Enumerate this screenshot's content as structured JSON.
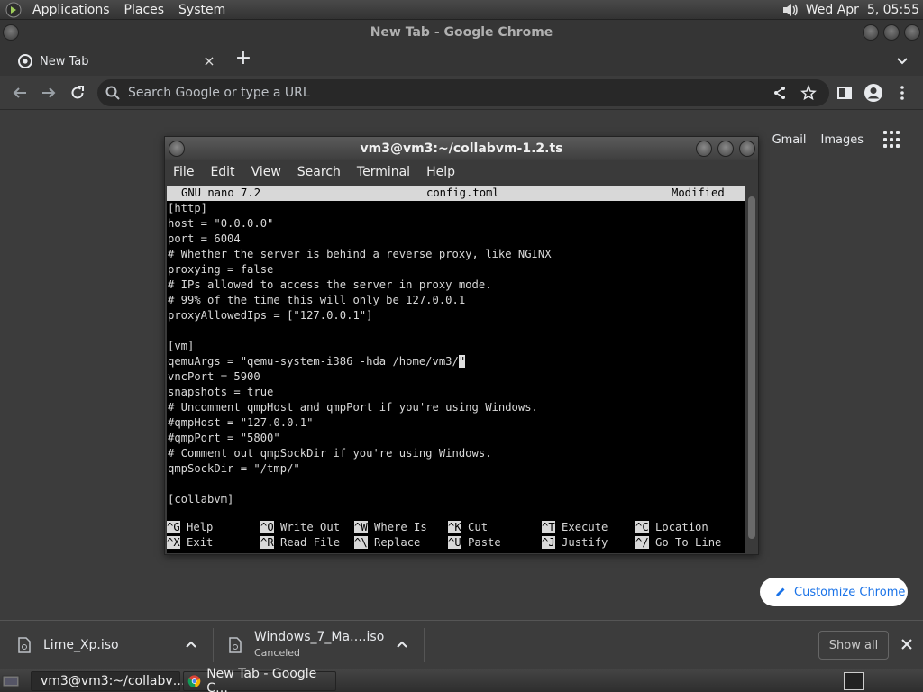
{
  "top_panel": {
    "menus": [
      "Applications",
      "Places",
      "System"
    ],
    "datetime": "Wed Apr  5, 05:55",
    "icon": "volume-icon"
  },
  "chrome": {
    "window_title": "New Tab - Google Chrome",
    "tab": {
      "title": "New Tab"
    },
    "omnibox_placeholder": "Search Google or type a URL",
    "ntp": {
      "gmail": "Gmail",
      "images": "Images",
      "customize": "Customize Chrome"
    }
  },
  "terminal": {
    "title": "vm3@vm3:~/collabvm-1.2.ts",
    "menus": [
      "File",
      "Edit",
      "View",
      "Search",
      "Terminal",
      "Help"
    ],
    "nano": {
      "version": "GNU nano 7.2",
      "filename": "config.toml",
      "status": "Modified",
      "lines": [
        "[http]",
        "host = \"0.0.0.0\"",
        "port = 6004",
        "# Whether the server is behind a reverse proxy, like NGINX",
        "proxying = false",
        "# IPs allowed to access the server in proxy mode.",
        "# 99% of the time this will only be 127.0.0.1",
        "proxyAllowedIps = [\"127.0.0.1\"]",
        "",
        "[vm]",
        "qemuArgs = \"qemu-system-i386 -hda /home/vm3/",
        "vncPort = 5900",
        "snapshots = true",
        "# Uncomment qmpHost and qmpPort if you're using Windows.",
        "#qmpHost = \"127.0.0.1\"",
        "#qmpPort = \"5800\"",
        "# Comment out qmpSockDir if you're using Windows.",
        "qmpSockDir = \"/tmp/\"",
        "",
        "[collabvm]"
      ],
      "cursor_char": "\"",
      "help_row1": [
        {
          "key": "^G",
          "label": " Help"
        },
        {
          "key": "^O",
          "label": " Write Out"
        },
        {
          "key": "^W",
          "label": " Where Is"
        },
        {
          "key": "^K",
          "label": " Cut"
        },
        {
          "key": "^T",
          "label": " Execute"
        },
        {
          "key": "^C",
          "label": " Location"
        }
      ],
      "help_row2": [
        {
          "key": "^X",
          "label": " Exit"
        },
        {
          "key": "^R",
          "label": " Read File"
        },
        {
          "key": "^\\",
          "label": " Replace"
        },
        {
          "key": "^U",
          "label": " Paste"
        },
        {
          "key": "^J",
          "label": " Justify"
        },
        {
          "key": "^/",
          "label": " Go To Line"
        }
      ]
    }
  },
  "downloads": {
    "items": [
      {
        "name": "Lime_Xp.iso",
        "status": ""
      },
      {
        "name": "Windows_7_Ma….iso",
        "status": "Canceled"
      }
    ],
    "show_all": "Show all"
  },
  "bottom_panel": {
    "tasks": [
      "vm3@vm3:~/collabv…",
      "New Tab - Google C…"
    ]
  },
  "colors": {
    "accent_blue": "#1a73e8",
    "terminal_bg": "#000000",
    "chrome_dark": "#3c3c3c"
  }
}
